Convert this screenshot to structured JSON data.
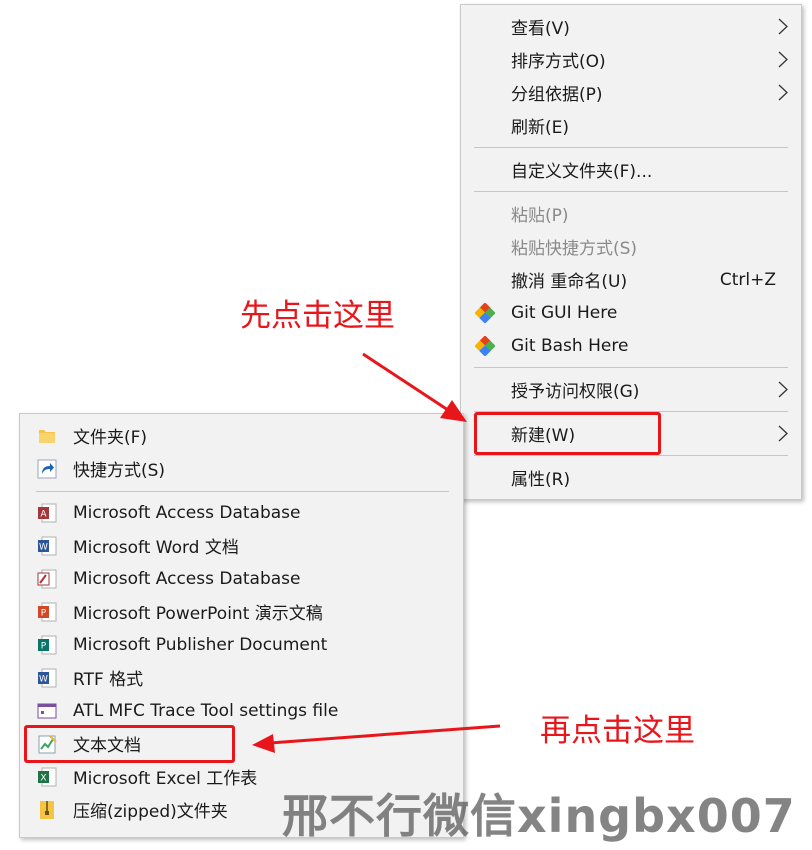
{
  "context_menu": {
    "items": [
      {
        "label": "查看(V)",
        "submenu": true
      },
      {
        "label": "排序方式(O)",
        "submenu": true
      },
      {
        "label": "分组依据(P)",
        "submenu": true
      },
      {
        "label": "刷新(E)"
      },
      {
        "label": "自定义文件夹(F)..."
      },
      {
        "label": "粘贴(P)",
        "disabled": true
      },
      {
        "label": "粘贴快捷方式(S)",
        "disabled": true
      },
      {
        "label": "撤消 重命名(U)",
        "shortcut": "Ctrl+Z"
      },
      {
        "label": "Git GUI Here",
        "icon": "git-icon"
      },
      {
        "label": "Git Bash Here",
        "icon": "git-icon"
      },
      {
        "label": "授予访问权限(G)",
        "submenu": true
      },
      {
        "label": "新建(W)",
        "submenu": true
      },
      {
        "label": "属性(R)"
      }
    ]
  },
  "new_submenu": {
    "items": [
      {
        "label": "文件夹(F)",
        "icon": "folder-icon"
      },
      {
        "label": "快捷方式(S)",
        "icon": "shortcut-icon"
      },
      {
        "label": "Microsoft Access Database",
        "icon": "access-icon"
      },
      {
        "label": "Microsoft Word 文档",
        "icon": "word-icon"
      },
      {
        "label": "Microsoft Access Database",
        "icon": "access-icon"
      },
      {
        "label": "Microsoft PowerPoint 演示文稿",
        "icon": "powerpoint-icon"
      },
      {
        "label": "Microsoft Publisher Document",
        "icon": "publisher-icon"
      },
      {
        "label": "RTF 格式",
        "icon": "rtf-icon"
      },
      {
        "label": "ATL MFC Trace Tool settings file",
        "icon": "trace-tool-icon"
      },
      {
        "label": "文本文档",
        "icon": "text-document-icon"
      },
      {
        "label": "Microsoft Excel 工作表",
        "icon": "excel-icon"
      },
      {
        "label": "压缩(zipped)文件夹",
        "icon": "zip-folder-icon"
      }
    ]
  },
  "annotations": {
    "first": "先点击这里",
    "second": "再点击这里"
  },
  "watermark": "邢不行微信xingbx007",
  "colors": {
    "menu_bg": "#f2f2f2",
    "annotation_red": "#e8161b",
    "disabled_text": "#8a8a8a"
  }
}
